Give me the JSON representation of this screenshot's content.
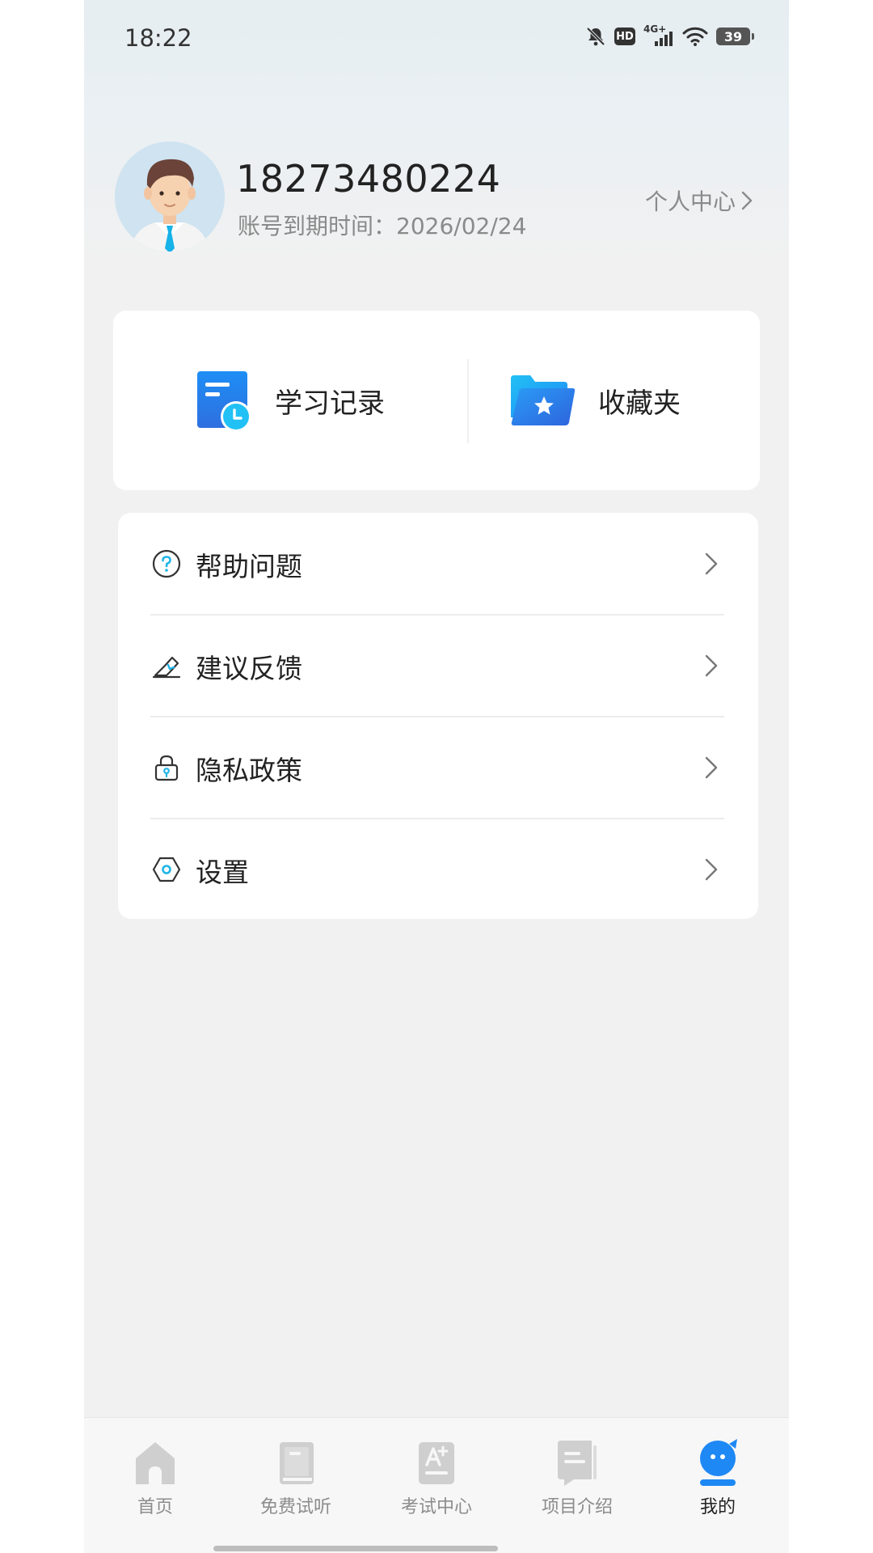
{
  "status_bar": {
    "time": "18:22",
    "hd_label": "HD",
    "network_label": "4G+",
    "battery": "39"
  },
  "profile": {
    "phone": "18273480224",
    "expire_label": "账号到期时间：",
    "expire_date": "2026/02/24",
    "personal_center": "个人中心"
  },
  "quick_actions": {
    "study_record": "学习记录",
    "favorites": "收藏夹"
  },
  "menu": {
    "items": [
      {
        "label": "帮助问题",
        "icon": "help-icon"
      },
      {
        "label": "建议反馈",
        "icon": "feedback-icon"
      },
      {
        "label": "隐私政策",
        "icon": "privacy-lock-icon"
      },
      {
        "label": "设置",
        "icon": "settings-icon"
      }
    ]
  },
  "bottom_nav": {
    "items": [
      {
        "label": "首页",
        "icon": "home-icon"
      },
      {
        "label": "免费试听",
        "icon": "book-icon"
      },
      {
        "label": "考试中心",
        "icon": "exam-icon"
      },
      {
        "label": "项目介绍",
        "icon": "project-icon"
      },
      {
        "label": "我的",
        "icon": "me-icon"
      }
    ],
    "active_index": 4
  },
  "colors": {
    "accent": "#1e88f5",
    "accent_light": "#22c1f5",
    "inactive": "#c8c8c8",
    "bg": "#f1f1f1"
  }
}
